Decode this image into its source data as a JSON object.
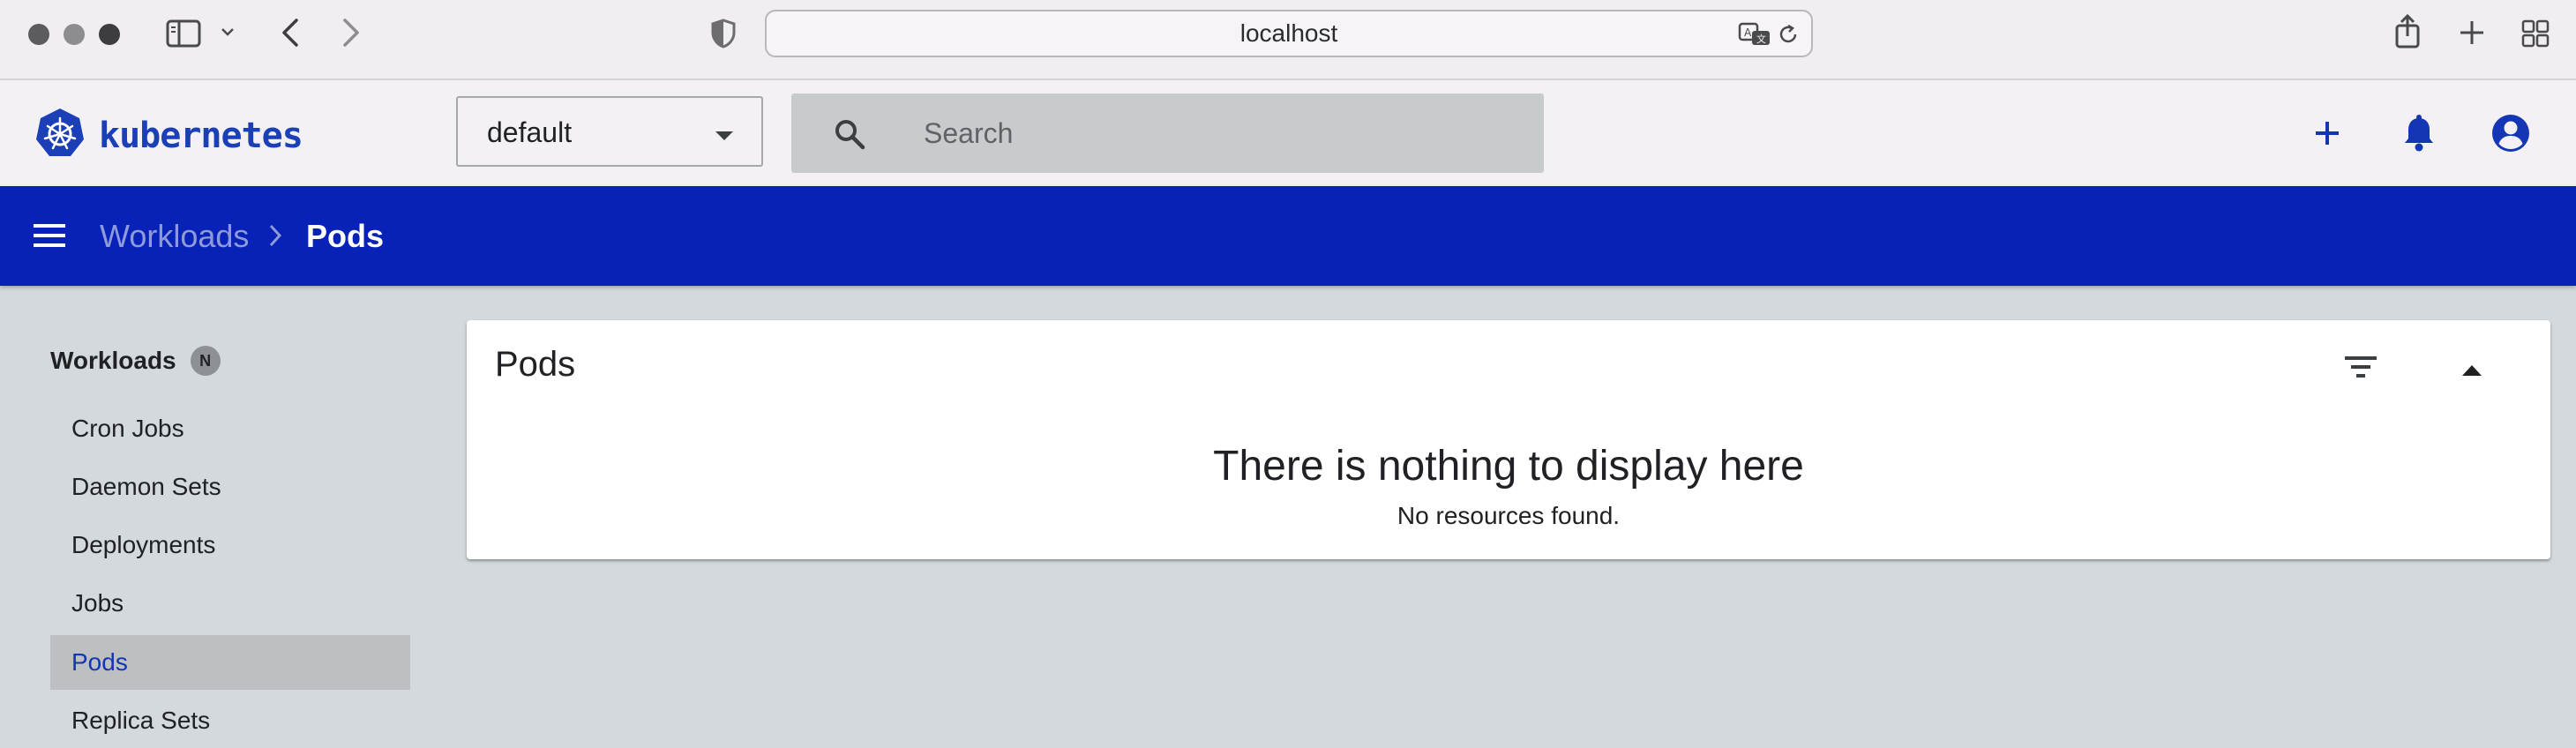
{
  "browser": {
    "url": "localhost",
    "icons": [
      "sidebar-toggle-icon",
      "chevron-down-icon",
      "back-icon",
      "forward-icon",
      "shield-icon",
      "translate-icon",
      "reload-icon",
      "share-icon",
      "new-tab-icon",
      "tab-overview-icon"
    ]
  },
  "header": {
    "brand": "kubernetes",
    "namespace": "default",
    "search_placeholder": "Search"
  },
  "toolbar": {
    "breadcrumb_parent": "Workloads",
    "breadcrumb_current": "Pods"
  },
  "sidebar": {
    "group_label": "Workloads",
    "group_badge": "N",
    "items": [
      {
        "label": "Cron Jobs",
        "active": false
      },
      {
        "label": "Daemon Sets",
        "active": false
      },
      {
        "label": "Deployments",
        "active": false
      },
      {
        "label": "Jobs",
        "active": false
      },
      {
        "label": "Pods",
        "active": true
      },
      {
        "label": "Replica Sets",
        "active": false
      }
    ]
  },
  "card": {
    "title": "Pods",
    "empty_title": "There is nothing to display here",
    "empty_subtitle": "No resources found."
  },
  "colors": {
    "toolbar_bg": "#0822b8",
    "accent": "#1336b5",
    "page_bg": "#d3d9dc"
  }
}
